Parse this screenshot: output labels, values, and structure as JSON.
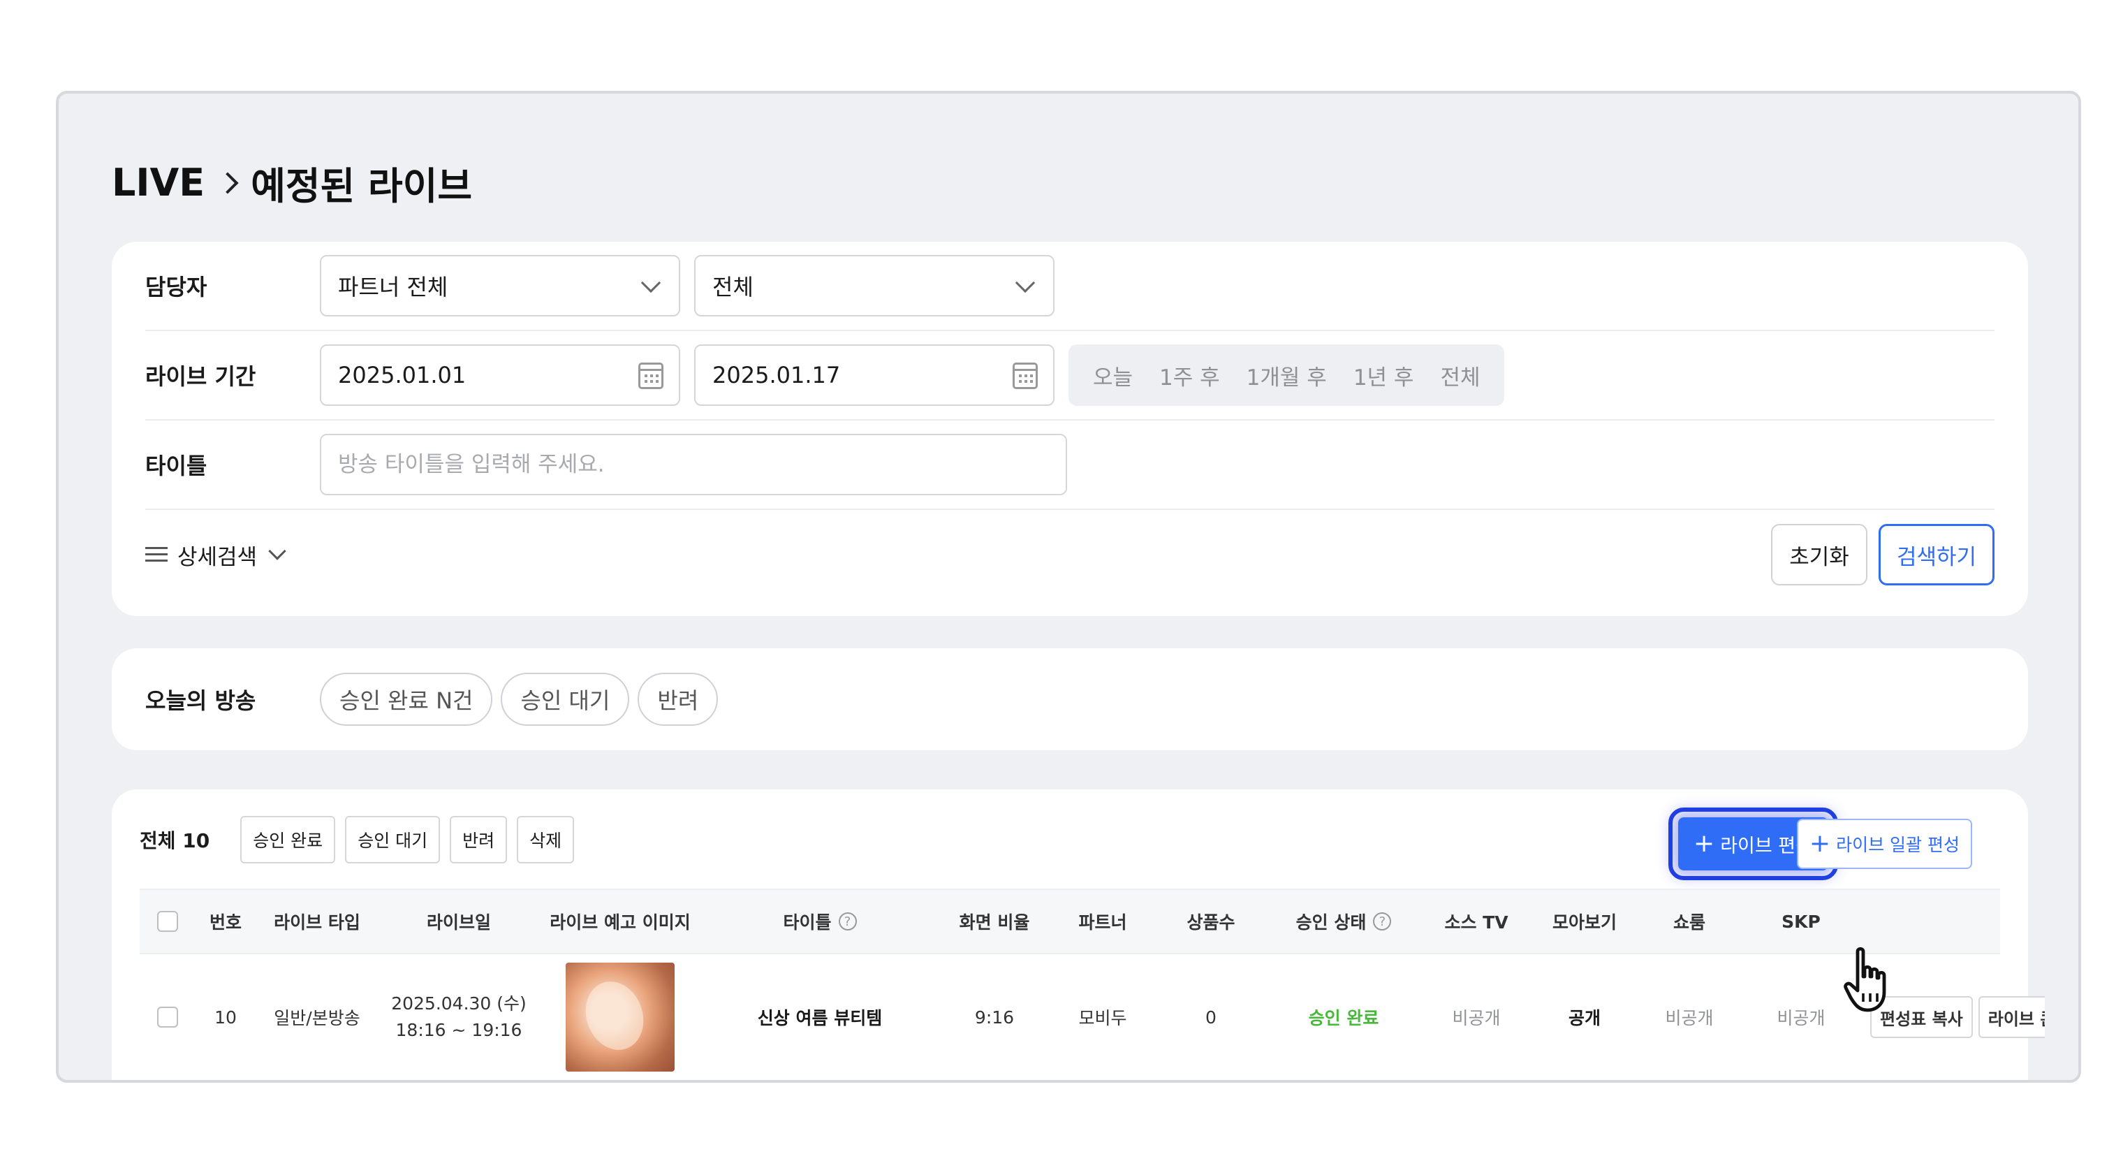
{
  "breadcrumb": {
    "root": "LIVE",
    "current": "예정된 라이브"
  },
  "filters": {
    "manager_label": "담당자",
    "partner_select": "파트너 전체",
    "all_select": "전체",
    "period_label": "라이브 기간",
    "start_date": "2025.01.01",
    "end_date": "2025.01.17",
    "quick_ranges": [
      "오늘",
      "1주 후",
      "1개월 후",
      "1년 후",
      "전체"
    ],
    "title_label": "타이틀",
    "title_placeholder": "방송 타이틀을 입력해 주세요.",
    "detail_search": "상세검색",
    "reset": "초기화",
    "search": "검색하기"
  },
  "today": {
    "label": "오늘의 방송",
    "chips": [
      "승인 완료 N건",
      "승인 대기",
      "반려"
    ]
  },
  "list": {
    "total": "전체 10",
    "status_buttons": [
      "승인 완료",
      "승인 대기",
      "반려",
      "삭제"
    ],
    "add_live": "라이브 편성",
    "add_bulk": "라이브 일괄 편성",
    "headers": [
      "번호",
      "라이브 타입",
      "라이브일",
      "라이브 예고 이미지",
      "타이틀",
      "화면 비율",
      "파트너",
      "상품수",
      "승인 상태",
      "소스 TV",
      "모아보기",
      "쇼룸",
      "SKP"
    ],
    "rows": [
      {
        "no": "10",
        "type": "일반/본방송",
        "date": "2025.04.30 (수)",
        "time": "18:16 ~ 19:16",
        "title": "신상 여름 뷰티템",
        "ratio": "9:16",
        "partner": "모비두",
        "products": "0",
        "approval": "승인 완료",
        "source_tv": "비공개",
        "collection": "공개",
        "showroom": "비공개",
        "skp": "비공개",
        "actions": [
          "편성표 복사",
          "라이브 콘솔"
        ]
      }
    ]
  },
  "colors": {
    "primary": "#2f6df6",
    "approved": "#48b83b",
    "highlight": "#1f3fe0"
  }
}
